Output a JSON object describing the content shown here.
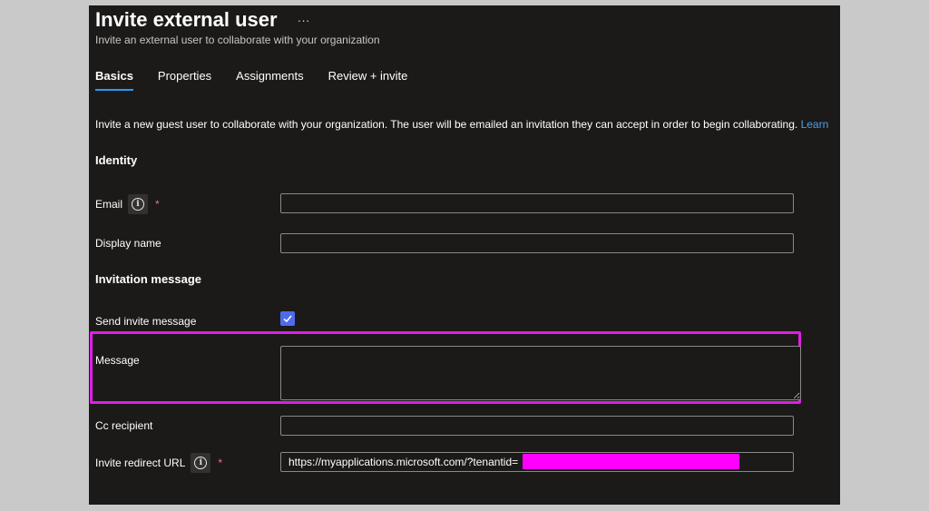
{
  "header": {
    "title": "Invite external user",
    "more": "···",
    "subtitle": "Invite an external user to collaborate with your organization"
  },
  "tabs": [
    {
      "label": "Basics",
      "active": true
    },
    {
      "label": "Properties",
      "active": false
    },
    {
      "label": "Assignments",
      "active": false
    },
    {
      "label": "Review + invite",
      "active": false
    }
  ],
  "intro": {
    "text": "Invite a new guest user to collaborate with your organization. The user will be emailed an invitation they can accept in order to begin collaborating.",
    "link": "Learn"
  },
  "identity": {
    "heading": "Identity",
    "email_label": "Email",
    "email_value": "",
    "display_name_label": "Display name",
    "display_name_value": ""
  },
  "invitation": {
    "heading": "Invitation message",
    "send_label": "Send invite message",
    "send_checked": true,
    "message_label": "Message",
    "message_value": "",
    "cc_label": "Cc recipient",
    "cc_value": "",
    "redirect_label": "Invite redirect URL",
    "redirect_value": "https://myapplications.microsoft.com/?tenantid="
  },
  "icons": {
    "info": "info-icon",
    "check": "checkmark-icon",
    "required": "*"
  },
  "colors": {
    "panel_bg": "#1b1a19",
    "accent": "#2899f5",
    "checkbox": "#4f6bed",
    "highlight": "#e21de6",
    "redaction": "#ff00ff",
    "required": "#f1707b"
  }
}
